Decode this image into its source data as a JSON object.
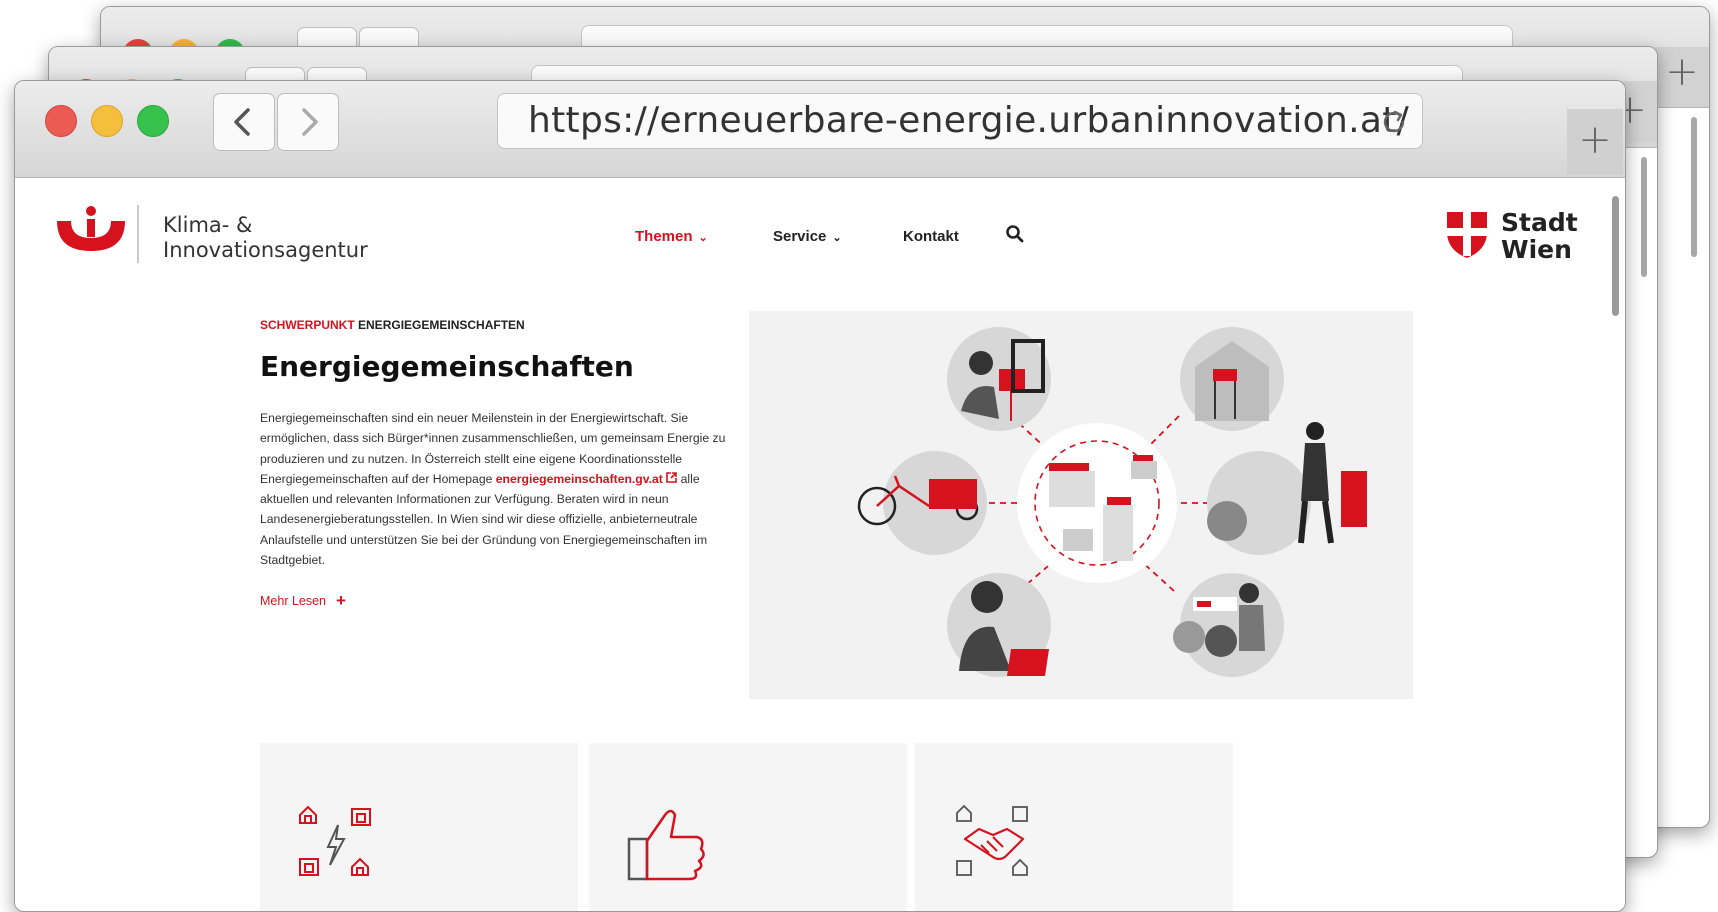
{
  "browser": {
    "url": "https://erneuerbare-energie.urbaninnovation.at/",
    "new_tab_label": "+",
    "back_label": "‹",
    "forward_label": "›"
  },
  "header": {
    "logo_text_line1": "Klima- &",
    "logo_text_line2": "Innovationsagentur",
    "nav": [
      {
        "label": "Themen",
        "active": true
      },
      {
        "label": "Service",
        "active": false
      },
      {
        "label": "Kontakt",
        "active": false
      }
    ],
    "partner_logo_line1": "Stadt",
    "partner_logo_line2": "Wien"
  },
  "article": {
    "kicker_red": "SCHWERPUNKT",
    "kicker_black": "ENERGIEGEMEINSCHAFTEN",
    "title": "Energiegemeinschaften",
    "body_1": "Energiegemeinschaften sind ein neuer Meilenstein in der Energiewirtschaft. Sie ermöglichen, dass sich Bürger*innen zusammenschließen, um gemeinsam Energie zu produzieren und zu nutzen. In Österreich stellt eine eigene Koordinationsstelle Energiegemeinschaften auf der Homepage ",
    "link": "energiegemeinschaften.gv.at",
    "body_2": " alle aktuellen und relevanten Informationen zur Verfügung. Beraten wird in neun Landesenergieberatungsstellen. In Wien sind wir diese offizielle, anbieterneutrale Anlaufstelle und unterstützen Sie bei der Gründung von Energiegemeinschaften im Stadtgebiet.",
    "read_more": "Mehr Lesen"
  },
  "colors": {
    "brand_red": "#d5121e",
    "text_dark": "#222222"
  },
  "icons": [
    "chevron-left-icon",
    "chevron-right-icon",
    "reload-icon",
    "search-icon",
    "chevron-down-icon",
    "external-link-icon",
    "houses-energy-icon",
    "thumbs-up-icon",
    "handshake-houses-icon"
  ]
}
